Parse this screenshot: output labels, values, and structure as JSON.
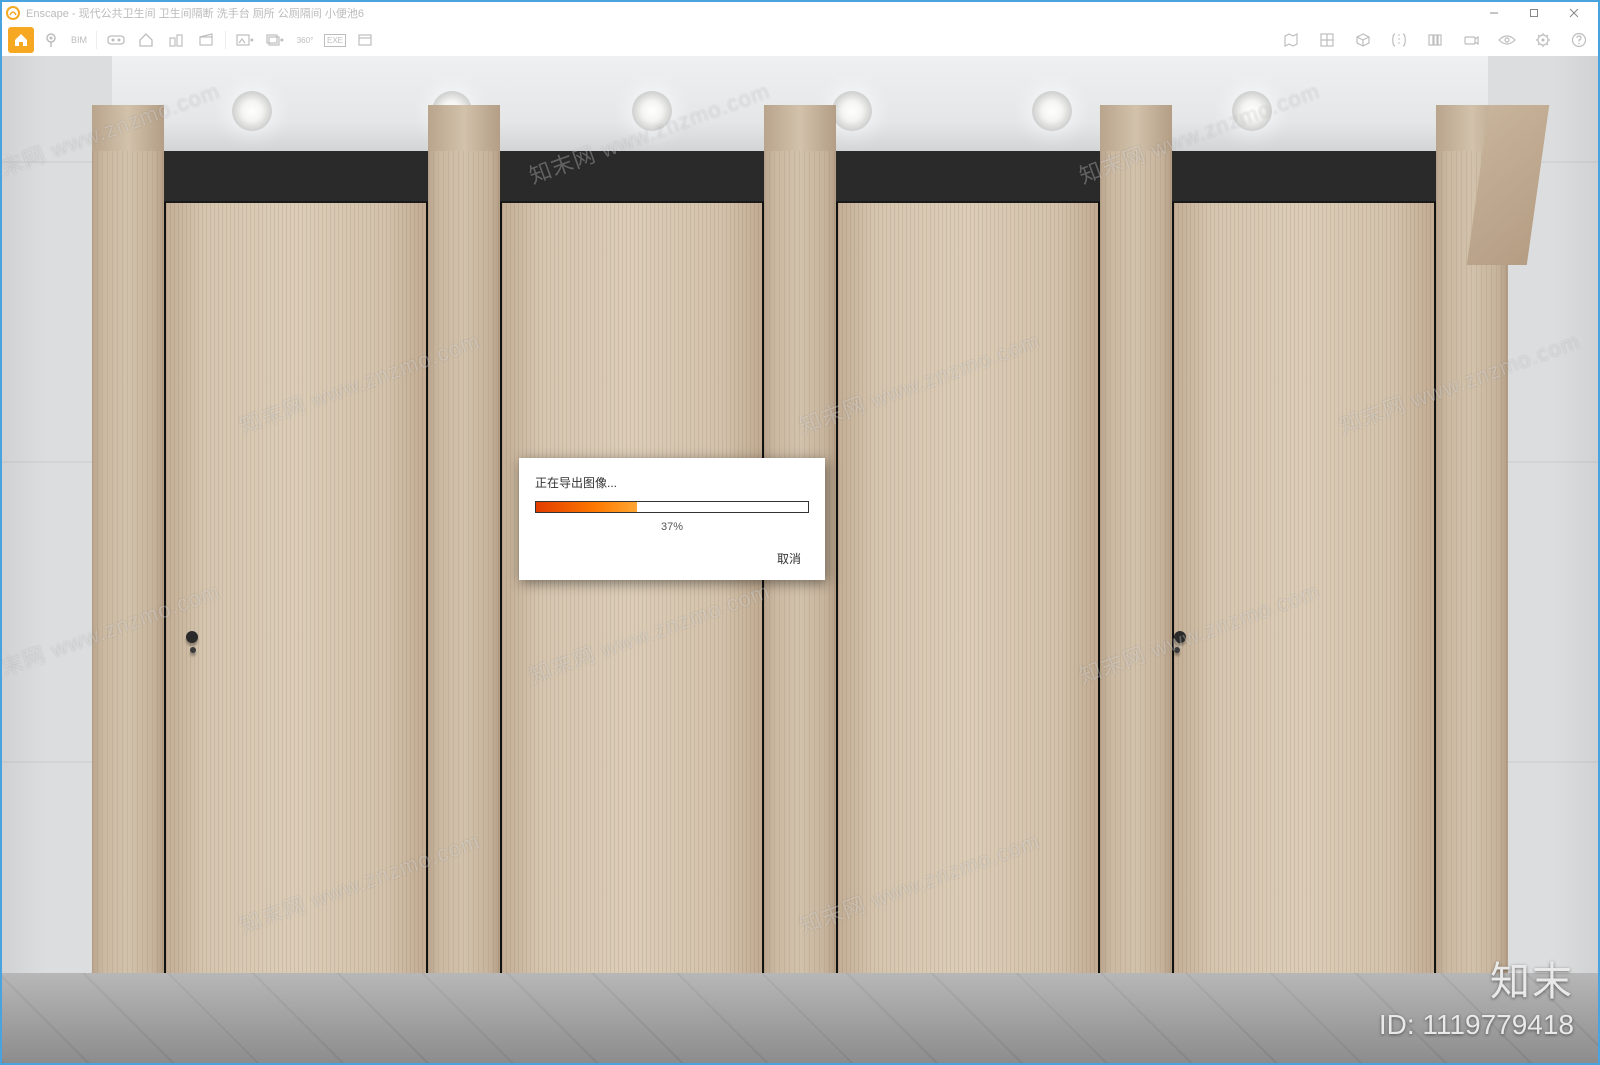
{
  "app": {
    "name": "Enscape",
    "title": "Enscape - 现代公共卫生间 卫生间隔断 洗手台 厕所 公厕隔间 小便池6"
  },
  "window_controls": {
    "minimize": "–",
    "maximize": "▢",
    "close": "×"
  },
  "toolbar": {
    "left_items": [
      {
        "icon": "home-icon",
        "label": ""
      },
      {
        "icon": "pin-icon",
        "label": ""
      },
      {
        "icon": "bim-icon",
        "label": "BIM"
      },
      {
        "icon": "vr-goggles-icon",
        "label": ""
      },
      {
        "icon": "house-outline-icon",
        "label": ""
      },
      {
        "icon": "buildings-icon",
        "label": ""
      },
      {
        "icon": "clapboard-icon",
        "label": ""
      },
      {
        "icon": "export-image-icon",
        "label": ""
      },
      {
        "icon": "export-batch-icon",
        "label": ""
      },
      {
        "icon": "panorama-360-icon",
        "label": "360°"
      },
      {
        "icon": "export-exe-icon",
        "label": "EXE"
      },
      {
        "icon": "export-web-icon",
        "label": ""
      }
    ],
    "right_items": [
      {
        "icon": "map-icon"
      },
      {
        "icon": "asset-library-icon"
      },
      {
        "icon": "cube-icon"
      },
      {
        "icon": "compare-icon"
      },
      {
        "icon": "views-icon"
      },
      {
        "icon": "camera-icon"
      },
      {
        "icon": "visibility-icon"
      },
      {
        "icon": "settings-icon"
      },
      {
        "icon": "help-icon"
      }
    ]
  },
  "dialog": {
    "title": "正在导出图像...",
    "percent_value": 37,
    "percent_label": "37%",
    "cancel_label": "取消"
  },
  "watermark": {
    "repeat_text": "知末网 www.znzmo.com",
    "brand": "知末",
    "id_label": "ID: 1119779418"
  },
  "colors": {
    "accent": "#f7a823",
    "window_border": "#4aa3df",
    "progress_start": "#e23c00",
    "progress_end": "#ffa733"
  }
}
